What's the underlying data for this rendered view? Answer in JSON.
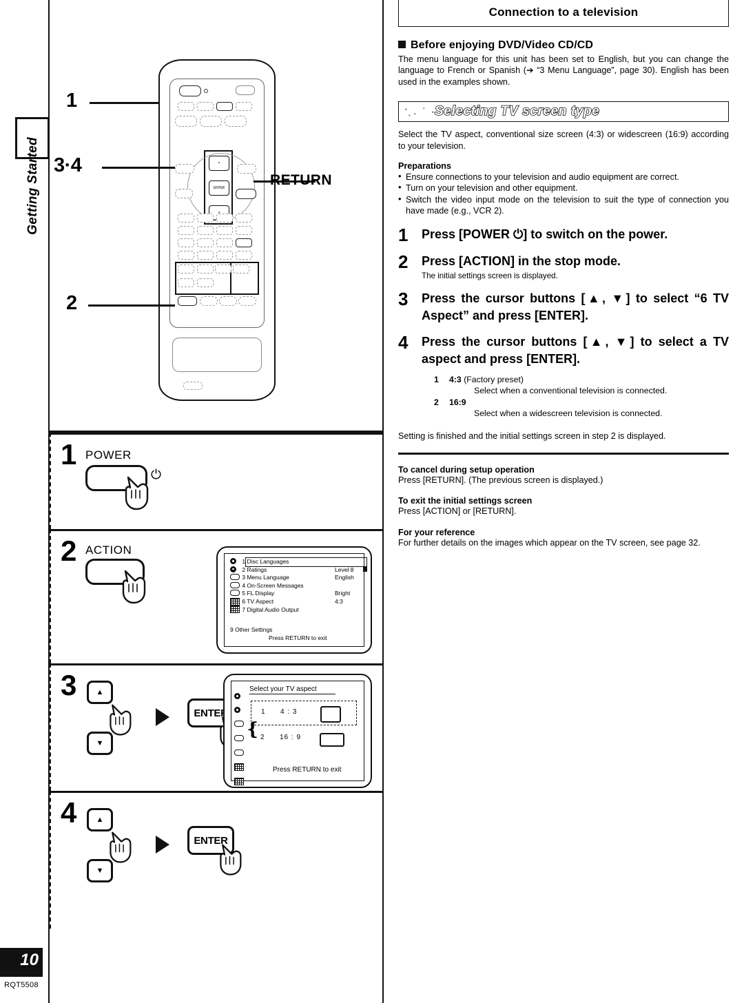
{
  "page": {
    "number": "10",
    "code": "RQT5508",
    "side_tab": "Getting Started"
  },
  "remote_callouts": {
    "one": "1",
    "three_four": "3·4",
    "two": "2",
    "return_label": "RETURN"
  },
  "steps_panels": [
    {
      "num": "1",
      "button_label": "POWER",
      "power_glyph": "⏻"
    },
    {
      "num": "2",
      "button_label": "ACTION"
    },
    {
      "num": "3",
      "enter_label": "ENTER",
      "up_glyph": "▲",
      "down_glyph": "▼"
    },
    {
      "num": "4",
      "enter_label": "ENTER",
      "up_glyph": "▲",
      "down_glyph": "▼"
    }
  ],
  "osd_initial": {
    "rows": [
      {
        "icon": "disc-icon",
        "label": "1 Disc Languages",
        "value": ""
      },
      {
        "icon": "disc-icon",
        "label": "2 Ratings",
        "value": "Level 8"
      },
      {
        "icon": "bar-icon",
        "label": "3 Menu Language",
        "value": "English"
      },
      {
        "icon": "bar-icon",
        "label": "4 On-Screen Messages",
        "value": ""
      },
      {
        "icon": "bar-icon",
        "label": "5 FL Display",
        "value": "Bright"
      },
      {
        "icon": "grid-icon",
        "label": "6 TV Aspect",
        "value": "4:3"
      },
      {
        "icon": "grid-icon",
        "label": "7 Digital Audio Output",
        "value": ""
      }
    ],
    "other": "9 Other Settings",
    "footer": "Press RETURN to exit"
  },
  "osd_aspect": {
    "title": "Select your TV aspect",
    "options": [
      {
        "num": "1",
        "ratio": "4 : 3"
      },
      {
        "num": "2",
        "ratio": "16 : 9"
      }
    ],
    "footer": "Press RETURN to exit"
  },
  "right": {
    "title": "Connection to a television",
    "before": {
      "heading": "Before enjoying DVD/Video CD/CD",
      "body": "The menu language for this unit has been set to English, but you can change the language to French or Spanish (➔ “3 Menu Language”, page 30). English has been used in the examples shown."
    },
    "banner": "Selecting TV screen type",
    "intro": "Select the TV aspect, conventional size screen (4:3) or widescreen (16:9) according to your television.",
    "preparations": {
      "heading": "Preparations",
      "items": [
        "Ensure connections to your television and audio equipment are correct.",
        "Turn on your television and other equipment.",
        "Switch the video input mode on the television to suit the type of connection you have made (e.g., VCR 2)."
      ]
    },
    "steps": [
      {
        "num": "1",
        "text": "Press [POWER ⏻] to switch on the power.",
        "sub": ""
      },
      {
        "num": "2",
        "text": "Press [ACTION] in the stop mode.",
        "sub": "The initial settings screen is displayed."
      },
      {
        "num": "3",
        "text": "Press the cursor buttons [▲, ▼] to select “6 TV Aspect” and press [ENTER].",
        "sub": ""
      },
      {
        "num": "4",
        "text": "Press the cursor buttons [▲, ▼] to select a TV aspect and press [ENTER].",
        "sub": ""
      }
    ],
    "aspect_options": [
      {
        "num": "1",
        "value": "4:3",
        "note": "(Factory preset)",
        "desc": "Select when a conventional television is connected."
      },
      {
        "num": "2",
        "value": "16:9",
        "note": "",
        "desc": "Select when a widescreen television is connected."
      }
    ],
    "finish": "Setting is finished and the initial settings screen in step 2 is displayed.",
    "sections": [
      {
        "title": "To cancel during setup operation",
        "text": "Press [RETURN]. (The previous screen is displayed.)"
      },
      {
        "title": "To exit the initial settings screen",
        "text": "Press [ACTION] or [RETURN]."
      },
      {
        "title": "For your reference",
        "text": "For further details on the images which appear on the TV screen, see page 32."
      }
    ]
  }
}
